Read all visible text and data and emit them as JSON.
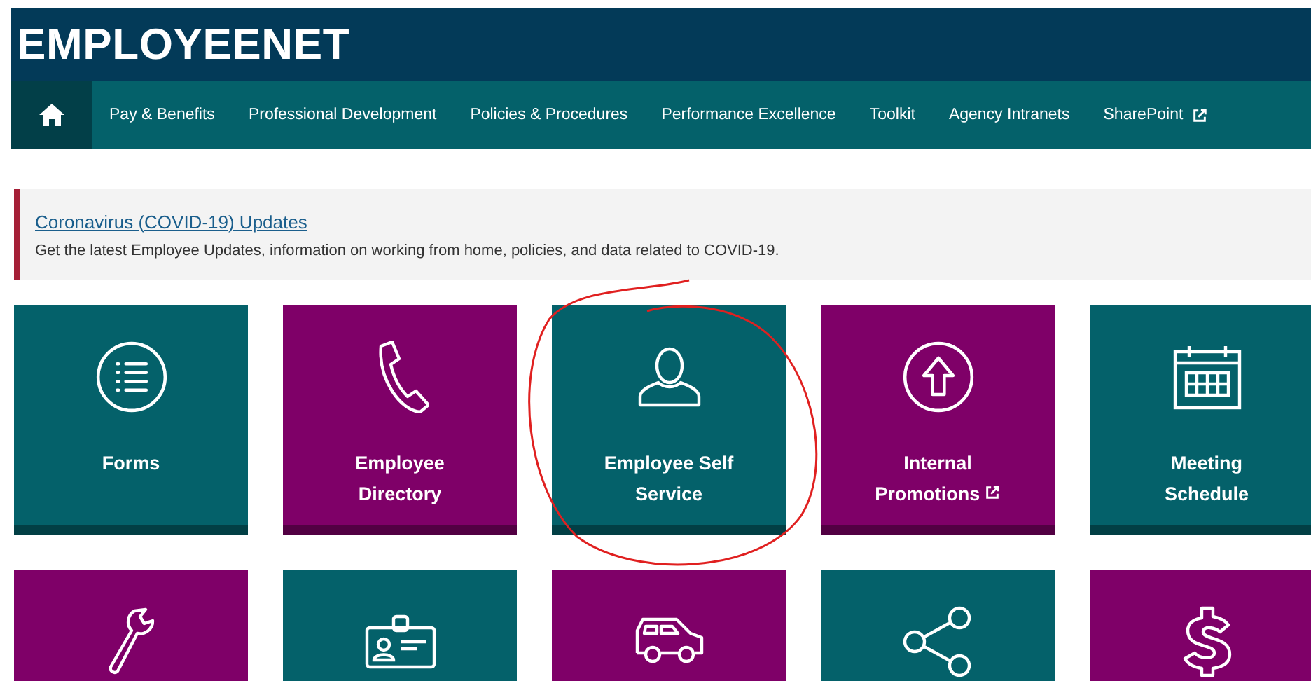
{
  "header": {
    "title": "EMPLOYEENET"
  },
  "nav": {
    "items": [
      {
        "label": "Pay & Benefits",
        "external": false
      },
      {
        "label": "Professional Development",
        "external": false
      },
      {
        "label": "Policies & Procedures",
        "external": false
      },
      {
        "label": "Performance Excellence",
        "external": false
      },
      {
        "label": "Toolkit",
        "external": false
      },
      {
        "label": "Agency Intranets",
        "external": false
      },
      {
        "label": "SharePoint",
        "external": true
      }
    ]
  },
  "alert": {
    "title": "Coronavirus (COVID-19) Updates",
    "text": "Get the latest Employee Updates, information on working from home, policies, and data related to COVID-19."
  },
  "tiles": [
    {
      "label": "Forms",
      "color": "#04616a",
      "external": false
    },
    {
      "label": "Employee Directory",
      "color": "#7f0068",
      "external": false
    },
    {
      "label": "Employee Self Service",
      "color": "#04616a",
      "external": false
    },
    {
      "label": "Internal Promotions",
      "color": "#7f0068",
      "external": true
    },
    {
      "label": "Meeting Schedule",
      "color": "#04616a",
      "external": false
    },
    {
      "color": "#7f0068"
    },
    {
      "color": "#04616a"
    },
    {
      "color": "#7f0068"
    },
    {
      "color": "#04616a"
    },
    {
      "color": "#7f0068"
    }
  ]
}
